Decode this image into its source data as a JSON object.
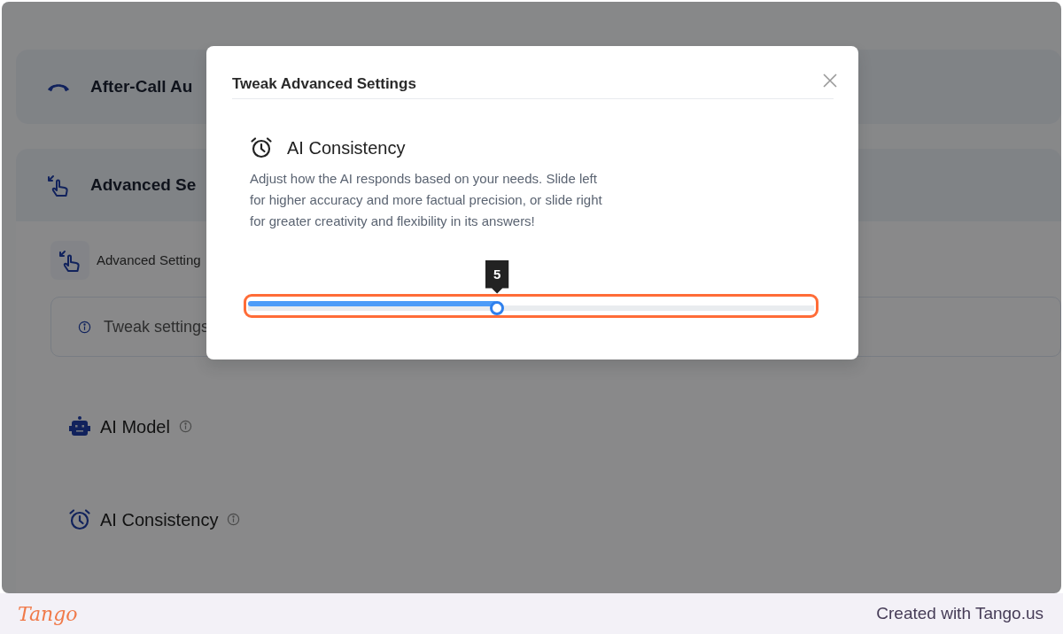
{
  "background": {
    "sections": [
      {
        "title": "After-Call Au"
      },
      {
        "title": "Advanced Se"
      }
    ],
    "subheader": {
      "title": "Advanced Setting"
    },
    "info_box": {
      "text": "Tweak settings"
    },
    "settings": [
      {
        "label": "AI Model"
      },
      {
        "label": "AI Consistency"
      }
    ]
  },
  "modal": {
    "title": "Tweak Advanced Settings",
    "section": {
      "title": "AI Consistency",
      "description": "Adjust how the AI responds based on your needs. Slide left for higher accuracy and more factual precision, or slide right for greater creativity and flexibility in its answers!"
    },
    "slider": {
      "level": 0.44,
      "value": "5"
    }
  },
  "footer": {
    "logo": "Tango",
    "credit": "Created with Tango.us"
  }
}
